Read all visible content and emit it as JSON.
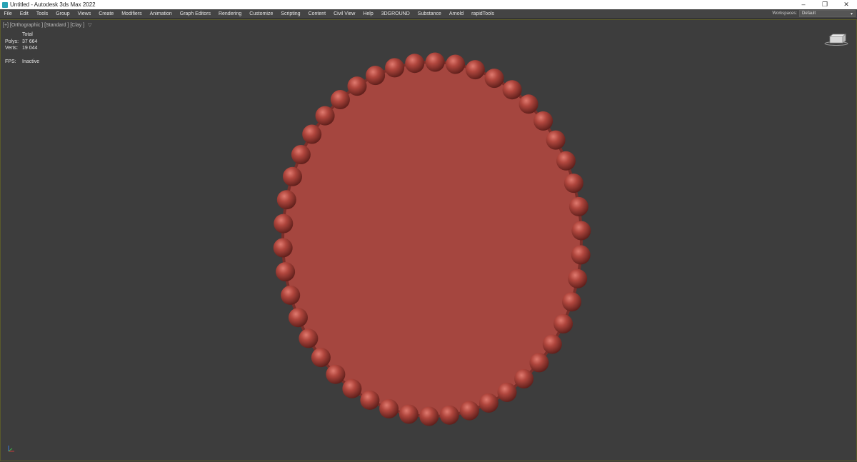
{
  "window": {
    "title": "Untitled - Autodesk 3ds Max 2022",
    "minimize": "–",
    "restore": "❐",
    "close": "✕"
  },
  "menu": {
    "items": [
      "File",
      "Edit",
      "Tools",
      "Group",
      "Views",
      "Create",
      "Modifiers",
      "Animation",
      "Graph Editors",
      "Rendering",
      "Customize",
      "Scripting",
      "Content",
      "Civil View",
      "Help",
      "3DGROUND",
      "Substance",
      "Arnold",
      "rapidTools"
    ],
    "workspaces_label": "Workspaces:",
    "workspace_value": "Default",
    "workspace_caret": "▾"
  },
  "viewport": {
    "label": "[+] [Orthographic ] [Standard ] [Clay ]",
    "filter_icon": "funnel-icon",
    "stats": {
      "header": "Total",
      "polys_label": "Polys:",
      "polys_value": "37 664",
      "verts_label": "Verts:",
      "verts_value": "19 044",
      "fps_label": "FPS:",
      "fps_value": "Inactive"
    },
    "object": {
      "disc_color": "#a5463f",
      "rim_color": "#7a2f2a",
      "bead_color": "#b0463d",
      "bead_count": 46
    }
  }
}
